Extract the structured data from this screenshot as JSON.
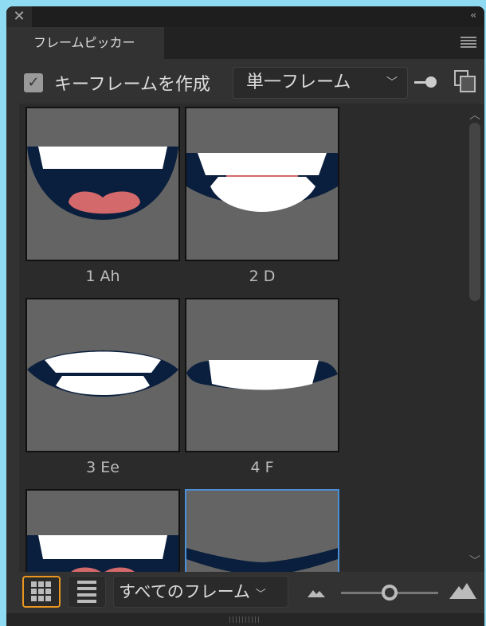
{
  "window": {
    "close_icon": "close-icon",
    "collapse_label": "‹‹"
  },
  "tab": {
    "label": "フレームピッカー"
  },
  "toolbar": {
    "checkbox_label": "キーフレームを作成",
    "checked": true,
    "mode_select": "単一フレーム"
  },
  "frames": [
    {
      "label": "1 Ah"
    },
    {
      "label": "2 D"
    },
    {
      "label": "3 Ee"
    },
    {
      "label": "4 F"
    },
    {
      "label": ""
    },
    {
      "label": ""
    }
  ],
  "bottom": {
    "filter_select": "すべてのフレーム",
    "size_slider": 0.5
  },
  "colors": {
    "mouth": "#0a1f3d",
    "teeth": "#ffffff",
    "tongue": "#d4696b",
    "bg": "#646464",
    "select": "#4b8fd9",
    "active": "#e8961f"
  }
}
